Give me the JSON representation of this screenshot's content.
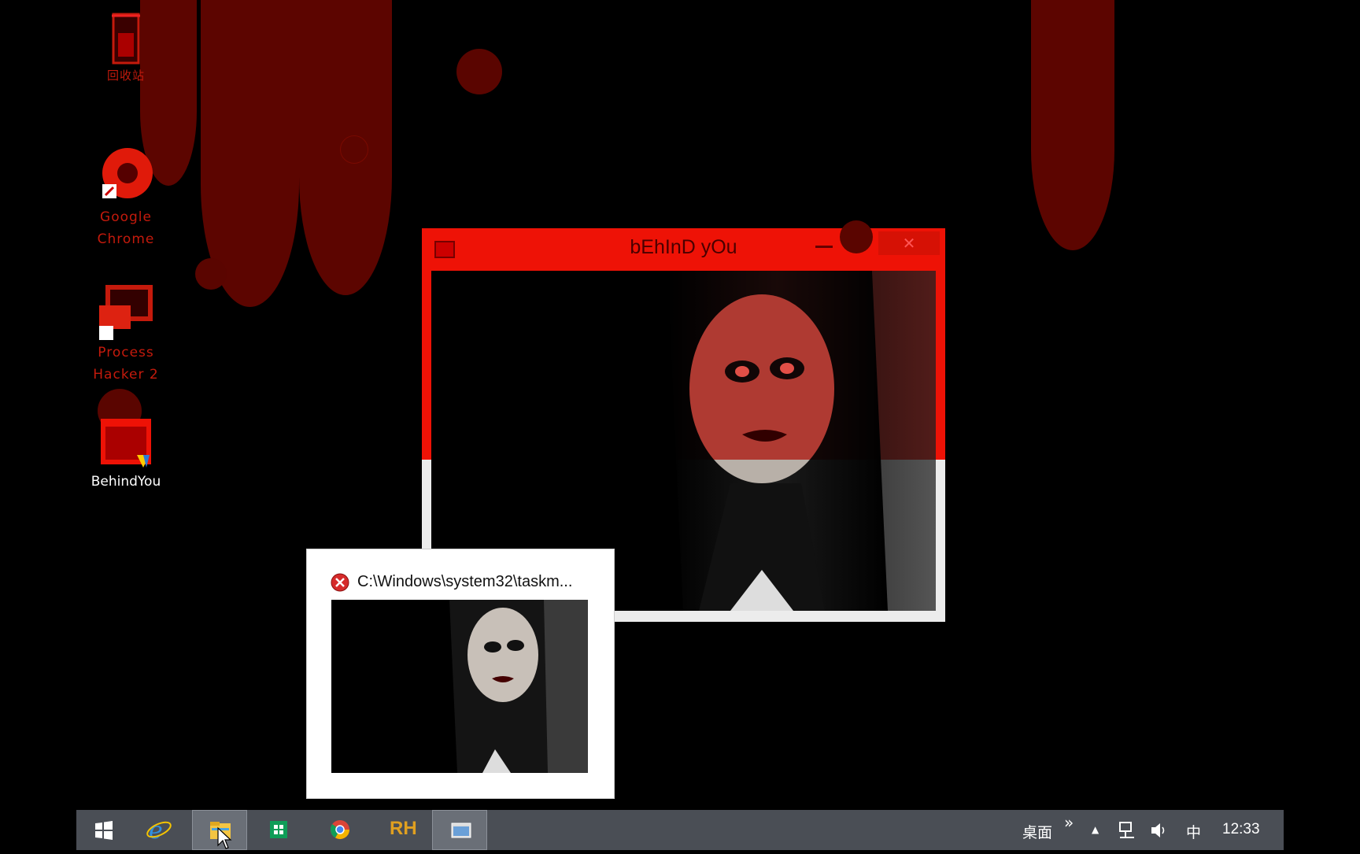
{
  "desktop": {
    "icons": [
      {
        "label": "回收站",
        "icon": "recycle-bin-icon"
      },
      {
        "label": "Google Chrome",
        "label_line1": "Google",
        "label_line2": "Chrome",
        "icon": "chrome-icon"
      },
      {
        "label": "Process Hacker 2",
        "label_line1": "Process",
        "label_line2": "Hacker 2",
        "icon": "process-hacker-icon"
      },
      {
        "label": "BehindYou",
        "icon": "behindyou-app-icon"
      }
    ]
  },
  "main_window": {
    "title": "bEhInD yOu",
    "minimize_glyph": "—",
    "close_glyph": "✕"
  },
  "preview": {
    "title": "C:\\Windows\\system32\\taskm..."
  },
  "taskbar": {
    "items": [
      "start-icon",
      "internet-explorer-icon",
      "file-explorer-icon",
      "store-icon",
      "chrome-icon",
      "rh-app-icon",
      "behindyou-window-icon"
    ],
    "rh_label": "RH",
    "desktop_label": "桌面",
    "overflow_glyph": "»",
    "show_hidden_glyph": "▲",
    "ime_label": "中",
    "clock": "12:33"
  },
  "colors": {
    "title_red": "#ee1206",
    "blood": "#5c0500",
    "taskbar": "#4a4e55"
  }
}
